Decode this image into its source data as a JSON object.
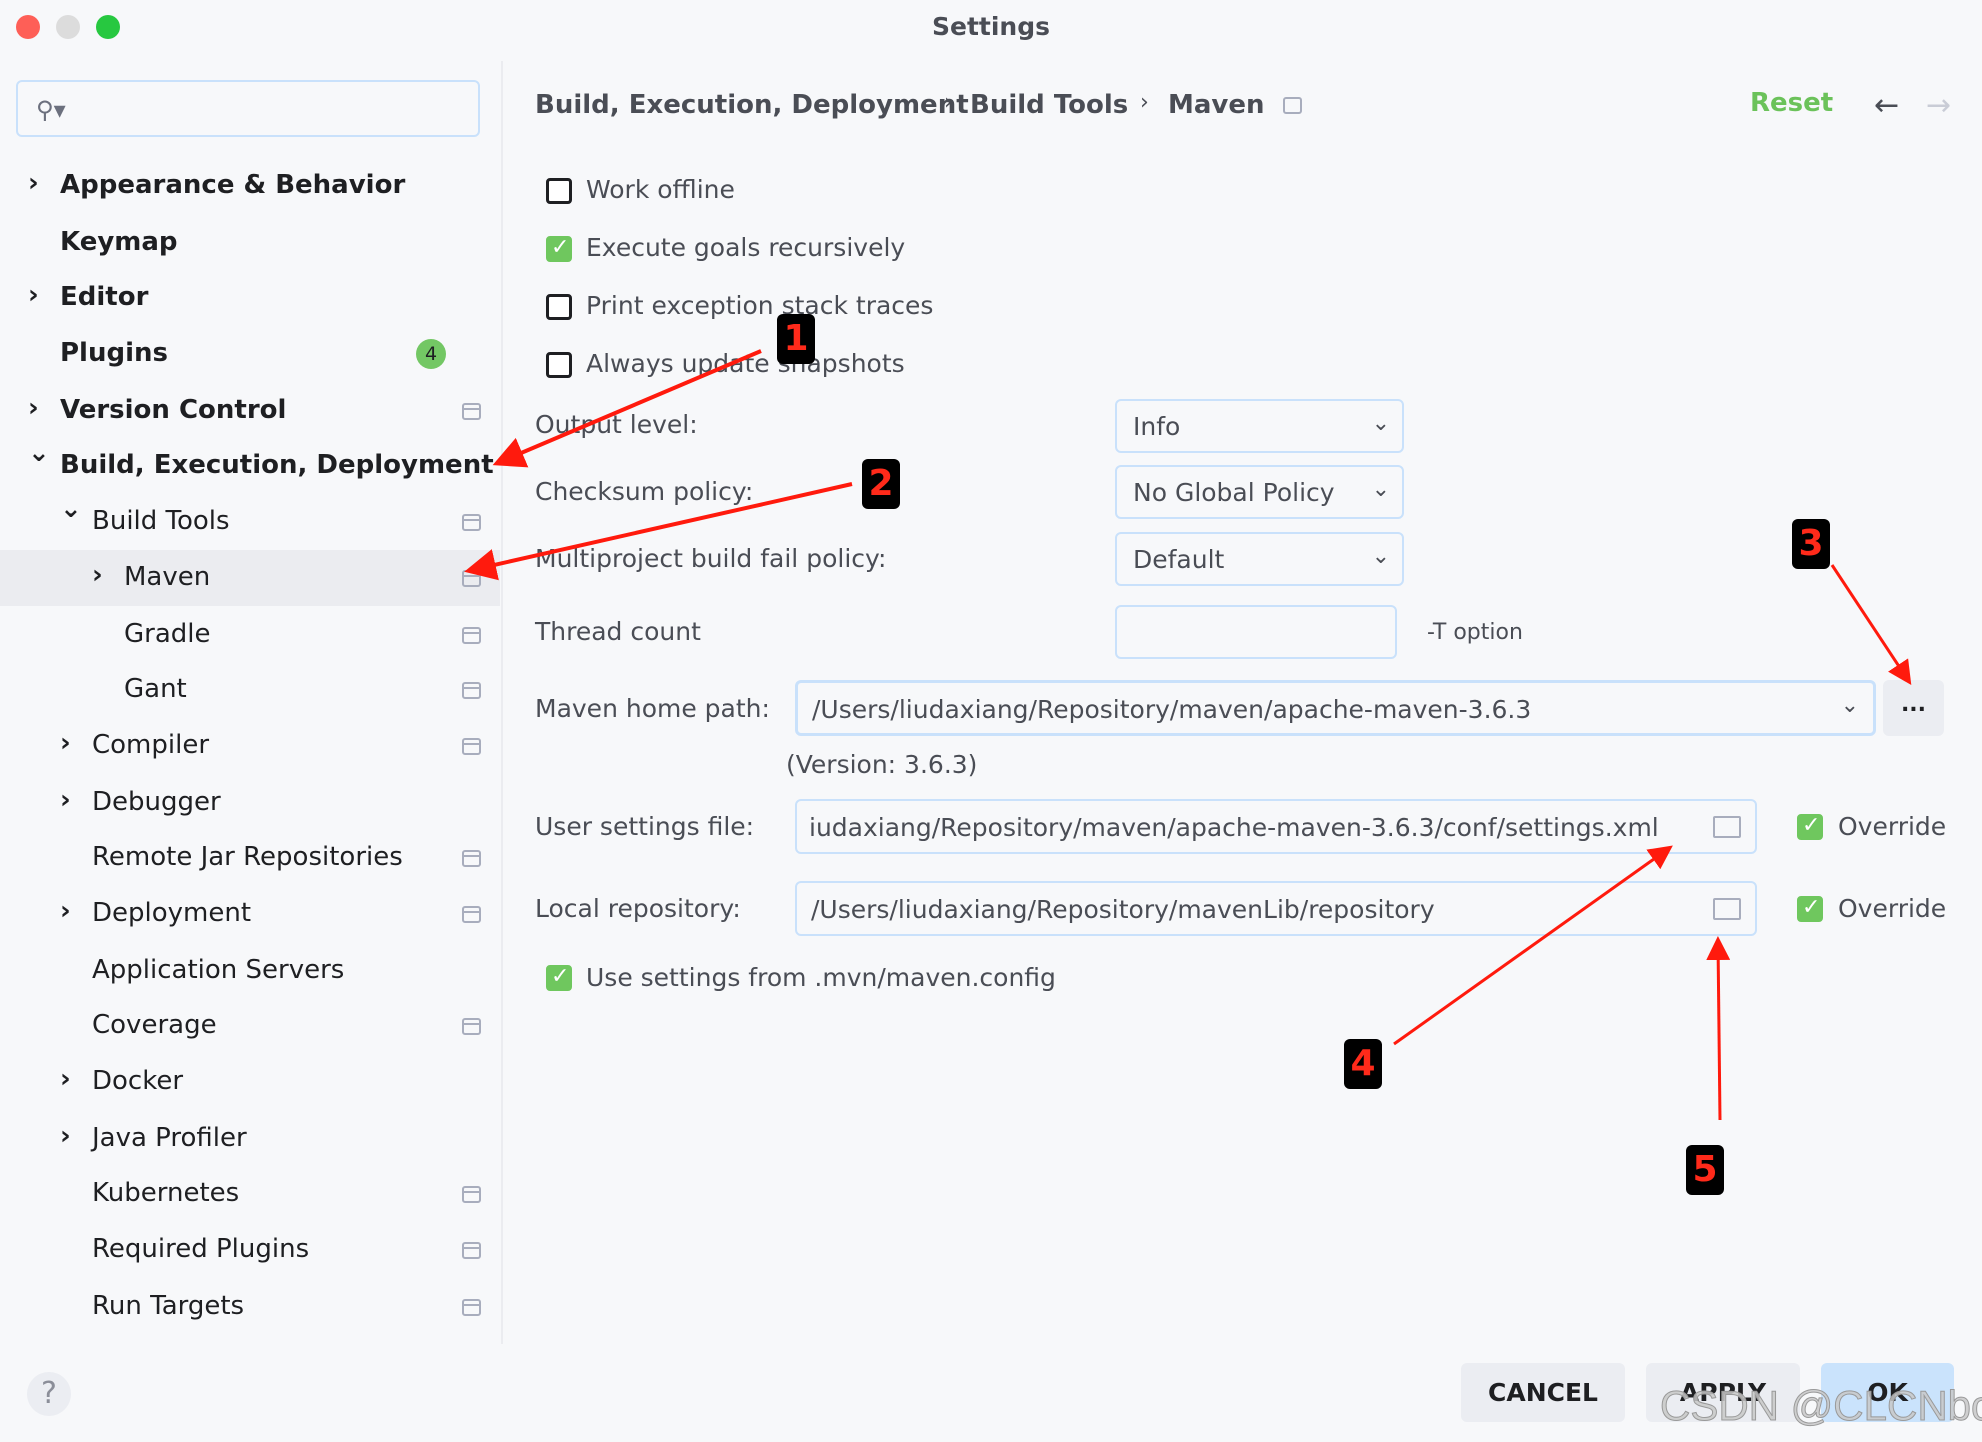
{
  "window": {
    "title": "Settings",
    "traffic_lights": {
      "close": "#fe5f57",
      "minimize": "#dcdcdc",
      "zoom": "#27c840"
    }
  },
  "search": {
    "icon": "search-icon",
    "value": "",
    "placeholder": ""
  },
  "sidebar": {
    "items": [
      {
        "label": "Appearance & Behavior",
        "level": 0,
        "expandable": true,
        "expanded": false,
        "bold": true,
        "pin": false
      },
      {
        "label": "Keymap",
        "level": 0,
        "expandable": false,
        "bold": true,
        "pin": false
      },
      {
        "label": "Editor",
        "level": 0,
        "expandable": true,
        "expanded": false,
        "bold": true,
        "pin": false
      },
      {
        "label": "Plugins",
        "level": 0,
        "expandable": false,
        "bold": true,
        "pin": false,
        "badge": "4"
      },
      {
        "label": "Version Control",
        "level": 0,
        "expandable": true,
        "expanded": false,
        "bold": true,
        "pin": true
      },
      {
        "label": "Build, Execution, Deployment",
        "level": 0,
        "expandable": true,
        "expanded": true,
        "bold": true,
        "pin": false
      },
      {
        "label": "Build Tools",
        "level": 1,
        "expandable": true,
        "expanded": true,
        "pin": true
      },
      {
        "label": "Maven",
        "level": 2,
        "expandable": true,
        "expanded": false,
        "pin": true,
        "selected": true
      },
      {
        "label": "Gradle",
        "level": 2,
        "expandable": false,
        "pin": true
      },
      {
        "label": "Gant",
        "level": 2,
        "expandable": false,
        "pin": true
      },
      {
        "label": "Compiler",
        "level": 1,
        "expandable": true,
        "expanded": false,
        "pin": true
      },
      {
        "label": "Debugger",
        "level": 1,
        "expandable": true,
        "expanded": false,
        "pin": false
      },
      {
        "label": "Remote Jar Repositories",
        "level": 1,
        "expandable": false,
        "pin": true
      },
      {
        "label": "Deployment",
        "level": 1,
        "expandable": true,
        "expanded": false,
        "pin": true
      },
      {
        "label": "Application Servers",
        "level": 1,
        "expandable": false,
        "pin": false
      },
      {
        "label": "Coverage",
        "level": 1,
        "expandable": false,
        "pin": true
      },
      {
        "label": "Docker",
        "level": 1,
        "expandable": true,
        "expanded": false,
        "pin": false
      },
      {
        "label": "Java Profiler",
        "level": 1,
        "expandable": true,
        "expanded": false,
        "pin": false
      },
      {
        "label": "Kubernetes",
        "level": 1,
        "expandable": false,
        "pin": true
      },
      {
        "label": "Required Plugins",
        "level": 1,
        "expandable": false,
        "pin": true
      },
      {
        "label": "Run Targets",
        "level": 1,
        "expandable": false,
        "pin": true
      }
    ]
  },
  "header": {
    "breadcrumb": [
      "Build, Execution, Deployment",
      "Build Tools",
      "Maven"
    ],
    "separator": "›",
    "reset_label": "Reset",
    "back_icon": "←",
    "forward_icon": "→",
    "reset_color": "#6bc25a"
  },
  "maven": {
    "checkboxes": [
      {
        "label": "Work offline",
        "checked": false
      },
      {
        "label": "Execute goals recursively",
        "checked": true
      },
      {
        "label": "Print exception stack traces",
        "checked": false
      },
      {
        "label": "Always update snapshots",
        "checked": false
      }
    ],
    "output_level": {
      "label": "Output level:",
      "value": "Info"
    },
    "checksum_policy": {
      "label": "Checksum policy:",
      "value": "No Global Policy"
    },
    "multiproject_fail_policy": {
      "label": "Multiproject build fail policy:",
      "value": "Default"
    },
    "thread_count": {
      "label": "Thread count",
      "value": "",
      "hint": "-T option"
    },
    "home_path": {
      "label": "Maven home path:",
      "value": "/Users/liudaxiang/Repository/maven/apache-maven-3.6.3",
      "browse_label": "...",
      "version": "(Version: 3.6.3)"
    },
    "user_settings": {
      "label": "User settings file:",
      "value": "iudaxiang/Repository/maven/apache-maven-3.6.3/conf/settings.xml",
      "override_label": "Override",
      "override": true
    },
    "local_repository": {
      "label": "Local repository:",
      "value": "/Users/liudaxiang/Repository/mavenLib/repository",
      "override_label": "Override",
      "override": true
    },
    "use_mvn_config": {
      "label": "Use settings from .mvn/maven.config",
      "checked": true
    }
  },
  "footer": {
    "help_label": "?",
    "cancel_label": "CANCEL",
    "apply_label": "APPLY",
    "ok_label": "OK"
  },
  "annotations": [
    "1",
    "2",
    "3",
    "4",
    "5"
  ],
  "watermark": "CSDN @CLCNboss"
}
